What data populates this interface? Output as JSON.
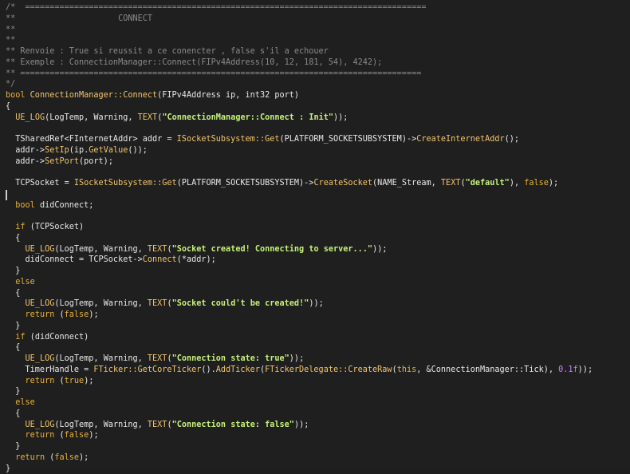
{
  "editor": {
    "lines": [
      [
        {
          "t": "/*  ==================================================================================",
          "c": "comment"
        }
      ],
      [
        {
          "t": "**                     CONNECT",
          "c": "comment"
        }
      ],
      [
        {
          "t": "**",
          "c": "comment"
        }
      ],
      [
        {
          "t": "**",
          "c": "comment"
        }
      ],
      [
        {
          "t": "** Renvoie : True si reussit a ce conencter , false s'il a echouer",
          "c": "comment"
        }
      ],
      [
        {
          "t": "** Exemple : ConnectionManager::Connect(FIPv4Address(10, 12, 181, 54), 4242);",
          "c": "comment"
        }
      ],
      [
        {
          "t": "** ==================================================================================",
          "c": "comment"
        }
      ],
      [
        {
          "t": "*/",
          "c": "comment"
        }
      ],
      [
        {
          "t": "bool ",
          "c": "kw"
        },
        {
          "t": "ConnectionManager::Connect",
          "c": "fn"
        },
        {
          "t": "(FIPv4Address ip, int32 port)",
          "c": "txt"
        }
      ],
      [
        {
          "t": "{",
          "c": "txt"
        }
      ],
      [
        {
          "t": "  ",
          "c": "txt"
        },
        {
          "t": "UE_LOG",
          "c": "fn"
        },
        {
          "t": "(LogTemp, Warning, ",
          "c": "txt"
        },
        {
          "t": "TEXT",
          "c": "fn"
        },
        {
          "t": "(",
          "c": "txt"
        },
        {
          "t": "\"ConnectionManager::Connect : Init\"",
          "c": "str"
        },
        {
          "t": "));",
          "c": "txt"
        }
      ],
      [
        {
          "t": "",
          "c": "txt"
        }
      ],
      [
        {
          "t": "  TSharedRef<FInternetAddr> addr = ",
          "c": "txt"
        },
        {
          "t": "ISocketSubsystem::Get",
          "c": "fn"
        },
        {
          "t": "(PLATFORM_SOCKETSUBSYSTEM)->",
          "c": "txt"
        },
        {
          "t": "CreateInternetAddr",
          "c": "fn"
        },
        {
          "t": "();",
          "c": "txt"
        }
      ],
      [
        {
          "t": "  addr->",
          "c": "txt"
        },
        {
          "t": "SetIp",
          "c": "fn"
        },
        {
          "t": "(ip.",
          "c": "txt"
        },
        {
          "t": "GetValue",
          "c": "fn"
        },
        {
          "t": "());",
          "c": "txt"
        }
      ],
      [
        {
          "t": "  addr->",
          "c": "txt"
        },
        {
          "t": "SetPort",
          "c": "fn"
        },
        {
          "t": "(port);",
          "c": "txt"
        }
      ],
      [
        {
          "t": "",
          "c": "txt"
        }
      ],
      [
        {
          "t": "  TCPSocket = ",
          "c": "txt"
        },
        {
          "t": "ISocketSubsystem::Get",
          "c": "fn"
        },
        {
          "t": "(PLATFORM_SOCKETSUBSYSTEM)->",
          "c": "txt"
        },
        {
          "t": "CreateSocket",
          "c": "fn"
        },
        {
          "t": "(NAME_Stream, ",
          "c": "txt"
        },
        {
          "t": "TEXT",
          "c": "fn"
        },
        {
          "t": "(",
          "c": "txt"
        },
        {
          "t": "\"default\"",
          "c": "str"
        },
        {
          "t": "), ",
          "c": "txt"
        },
        {
          "t": "false",
          "c": "kw"
        },
        {
          "t": ");",
          "c": "txt"
        }
      ],
      [
        {
          "t": "",
          "c": "txt"
        }
      ],
      [
        {
          "t": "  ",
          "c": "txt"
        },
        {
          "t": "bool",
          "c": "kw"
        },
        {
          "t": " didConnect;",
          "c": "txt"
        }
      ],
      [
        {
          "t": "",
          "c": "txt"
        }
      ],
      [
        {
          "t": "  ",
          "c": "txt"
        },
        {
          "t": "if",
          "c": "kw"
        },
        {
          "t": " (TCPSocket)",
          "c": "txt"
        }
      ],
      [
        {
          "t": "  {",
          "c": "txt"
        }
      ],
      [
        {
          "t": "    ",
          "c": "txt"
        },
        {
          "t": "UE_LOG",
          "c": "fn"
        },
        {
          "t": "(LogTemp, Warning, ",
          "c": "txt"
        },
        {
          "t": "TEXT",
          "c": "fn"
        },
        {
          "t": "(",
          "c": "txt"
        },
        {
          "t": "\"Socket created! Connecting to server...\"",
          "c": "str"
        },
        {
          "t": "));",
          "c": "txt"
        }
      ],
      [
        {
          "t": "    didConnect = TCPSocket->",
          "c": "txt"
        },
        {
          "t": "Connect",
          "c": "fn"
        },
        {
          "t": "(*addr);",
          "c": "txt"
        }
      ],
      [
        {
          "t": "  }",
          "c": "txt"
        }
      ],
      [
        {
          "t": "  ",
          "c": "txt"
        },
        {
          "t": "else",
          "c": "kw"
        }
      ],
      [
        {
          "t": "  {",
          "c": "txt"
        }
      ],
      [
        {
          "t": "    ",
          "c": "txt"
        },
        {
          "t": "UE_LOG",
          "c": "fn"
        },
        {
          "t": "(LogTemp, Warning, ",
          "c": "txt"
        },
        {
          "t": "TEXT",
          "c": "fn"
        },
        {
          "t": "(",
          "c": "txt"
        },
        {
          "t": "\"Socket could't be created!\"",
          "c": "str"
        },
        {
          "t": "));",
          "c": "txt"
        }
      ],
      [
        {
          "t": "    ",
          "c": "txt"
        },
        {
          "t": "return",
          "c": "kw"
        },
        {
          "t": " (",
          "c": "txt"
        },
        {
          "t": "false",
          "c": "kw"
        },
        {
          "t": ");",
          "c": "txt"
        }
      ],
      [
        {
          "t": "  }",
          "c": "txt"
        }
      ],
      [
        {
          "t": "  ",
          "c": "txt"
        },
        {
          "t": "if",
          "c": "kw"
        },
        {
          "t": " (didConnect)",
          "c": "txt"
        }
      ],
      [
        {
          "t": "  {",
          "c": "txt"
        }
      ],
      [
        {
          "t": "    ",
          "c": "txt"
        },
        {
          "t": "UE_LOG",
          "c": "fn"
        },
        {
          "t": "(LogTemp, Warning, ",
          "c": "txt"
        },
        {
          "t": "TEXT",
          "c": "fn"
        },
        {
          "t": "(",
          "c": "txt"
        },
        {
          "t": "\"Connection state: true\"",
          "c": "str"
        },
        {
          "t": "));",
          "c": "txt"
        }
      ],
      [
        {
          "t": "    TimerHandle = ",
          "c": "txt"
        },
        {
          "t": "FTicker::GetCoreTicker",
          "c": "fn"
        },
        {
          "t": "().",
          "c": "txt"
        },
        {
          "t": "AddTicker",
          "c": "fn"
        },
        {
          "t": "(",
          "c": "txt"
        },
        {
          "t": "FTickerDelegate::CreateRaw",
          "c": "fn"
        },
        {
          "t": "(",
          "c": "txt"
        },
        {
          "t": "this",
          "c": "kw"
        },
        {
          "t": ", &ConnectionManager::Tick), ",
          "c": "txt"
        },
        {
          "t": "0.1f",
          "c": "num"
        },
        {
          "t": "));",
          "c": "txt"
        }
      ],
      [
        {
          "t": "    ",
          "c": "txt"
        },
        {
          "t": "return",
          "c": "kw"
        },
        {
          "t": " (",
          "c": "txt"
        },
        {
          "t": "true",
          "c": "kw"
        },
        {
          "t": ");",
          "c": "txt"
        }
      ],
      [
        {
          "t": "  }",
          "c": "txt"
        }
      ],
      [
        {
          "t": "  ",
          "c": "txt"
        },
        {
          "t": "else",
          "c": "kw"
        }
      ],
      [
        {
          "t": "  {",
          "c": "txt"
        }
      ],
      [
        {
          "t": "    ",
          "c": "txt"
        },
        {
          "t": "UE_LOG",
          "c": "fn"
        },
        {
          "t": "(LogTemp, Warning, ",
          "c": "txt"
        },
        {
          "t": "TEXT",
          "c": "fn"
        },
        {
          "t": "(",
          "c": "txt"
        },
        {
          "t": "\"Connection state: false\"",
          "c": "str"
        },
        {
          "t": "));",
          "c": "txt"
        }
      ],
      [
        {
          "t": "    ",
          "c": "txt"
        },
        {
          "t": "return",
          "c": "kw"
        },
        {
          "t": " (",
          "c": "txt"
        },
        {
          "t": "false",
          "c": "kw"
        },
        {
          "t": ");",
          "c": "txt"
        }
      ],
      [
        {
          "t": "  }",
          "c": "txt"
        }
      ],
      [
        {
          "t": "  ",
          "c": "txt"
        },
        {
          "t": "return",
          "c": "kw"
        },
        {
          "t": " (",
          "c": "txt"
        },
        {
          "t": "false",
          "c": "kw"
        },
        {
          "t": ");",
          "c": "txt"
        }
      ],
      [
        {
          "t": "}",
          "c": "txt"
        }
      ]
    ]
  }
}
